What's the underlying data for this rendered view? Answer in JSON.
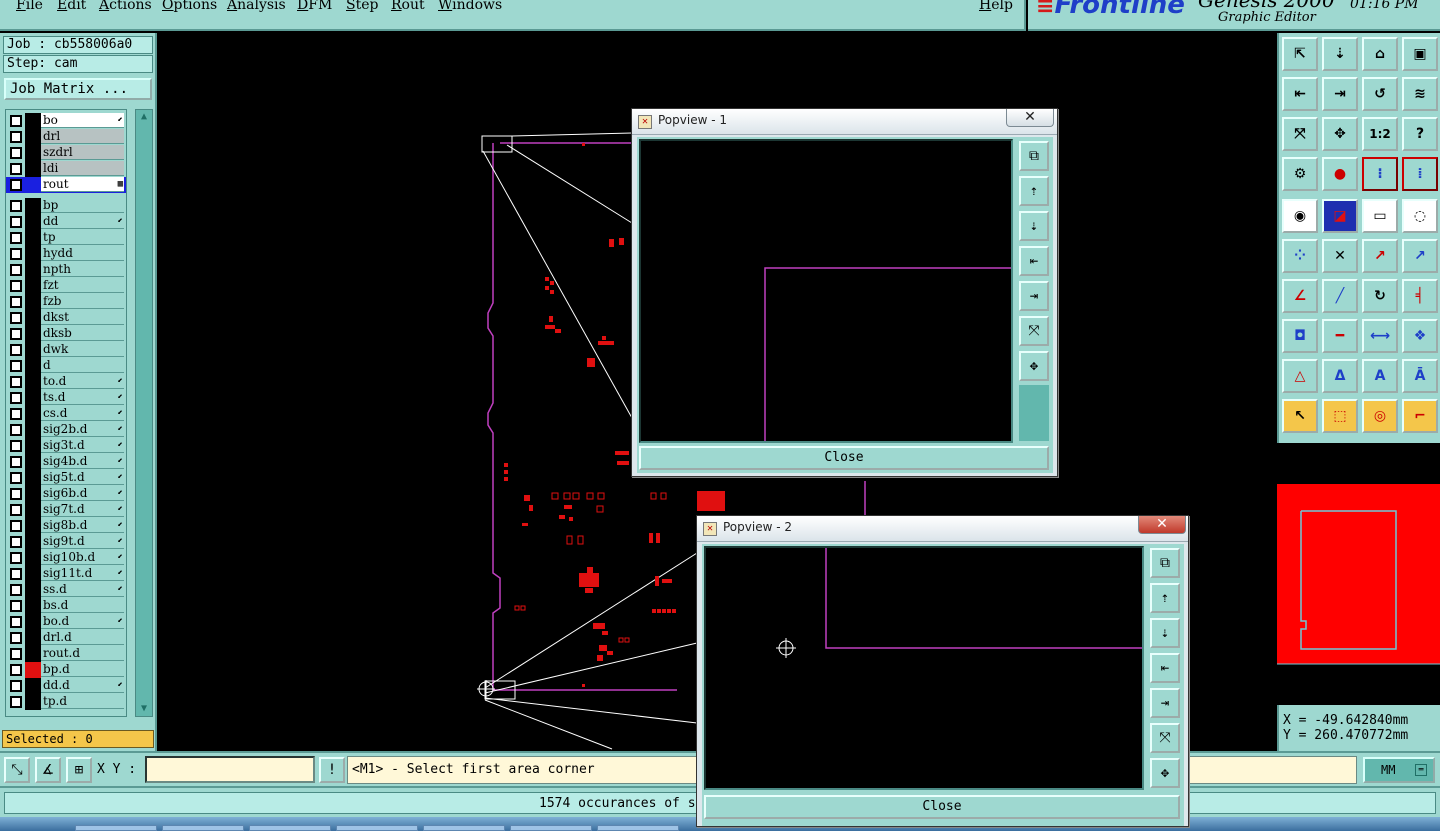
{
  "menu": {
    "items": [
      "File",
      "Edit",
      "Actions",
      "Options",
      "Analysis",
      "DFM",
      "Step",
      "Rout",
      "Windows"
    ],
    "help": "Help"
  },
  "brand": {
    "logo": "Frontline",
    "product": "Genesis 2000",
    "subtitle": "Graphic Editor",
    "time": "01:16 PM"
  },
  "job": {
    "job": "Job : cb558006a0",
    "step": "Step: cam",
    "matrix_button": "Job Matrix ..."
  },
  "layers": [
    {
      "name": "bo",
      "type": "white",
      "flag": "⬋",
      "sel": false
    },
    {
      "name": "drl",
      "type": "board",
      "flag": "",
      "sel": false
    },
    {
      "name": "szdrl",
      "type": "board",
      "flag": "",
      "sel": false
    },
    {
      "name": "ldi",
      "type": "board",
      "flag": "",
      "sel": false
    },
    {
      "name": "rout",
      "type": "white",
      "flag": "▦",
      "sel": true
    },
    {
      "name": "bp",
      "type": "",
      "flag": "",
      "sel": false
    },
    {
      "name": "dd",
      "type": "",
      "flag": "⬋",
      "sel": false
    },
    {
      "name": "tp",
      "type": "",
      "flag": "",
      "sel": false
    },
    {
      "name": "hydd",
      "type": "",
      "flag": "",
      "sel": false
    },
    {
      "name": "npth",
      "type": "",
      "flag": "",
      "sel": false
    },
    {
      "name": "fzt",
      "type": "",
      "flag": "",
      "sel": false
    },
    {
      "name": "fzb",
      "type": "",
      "flag": "",
      "sel": false
    },
    {
      "name": "dkst",
      "type": "",
      "flag": "",
      "sel": false
    },
    {
      "name": "dksb",
      "type": "",
      "flag": "",
      "sel": false
    },
    {
      "name": "dwk",
      "type": "",
      "flag": "",
      "sel": false
    },
    {
      "name": "d",
      "type": "",
      "flag": "",
      "sel": false
    },
    {
      "name": "to.d",
      "type": "",
      "flag": "⬋",
      "sel": false
    },
    {
      "name": "ts.d",
      "type": "",
      "flag": "⬋",
      "sel": false
    },
    {
      "name": "cs.d",
      "type": "",
      "flag": "⬋",
      "sel": false
    },
    {
      "name": "sig2b.d",
      "type": "",
      "flag": "⬋",
      "sel": false
    },
    {
      "name": "sig3t.d",
      "type": "",
      "flag": "⬋",
      "sel": false
    },
    {
      "name": "sig4b.d",
      "type": "",
      "flag": "⬋",
      "sel": false
    },
    {
      "name": "sig5t.d",
      "type": "",
      "flag": "⬋",
      "sel": false
    },
    {
      "name": "sig6b.d",
      "type": "",
      "flag": "⬋",
      "sel": false
    },
    {
      "name": "sig7t.d",
      "type": "",
      "flag": "⬋",
      "sel": false
    },
    {
      "name": "sig8b.d",
      "type": "",
      "flag": "⬋",
      "sel": false
    },
    {
      "name": "sig9t.d",
      "type": "",
      "flag": "⬋",
      "sel": false
    },
    {
      "name": "sig10b.d",
      "type": "",
      "flag": "⬋",
      "sel": false
    },
    {
      "name": "sig11t.d",
      "type": "",
      "flag": "⬋",
      "sel": false
    },
    {
      "name": "ss.d",
      "type": "",
      "flag": "⬋",
      "sel": false
    },
    {
      "name": "bs.d",
      "type": "",
      "flag": "",
      "sel": false
    },
    {
      "name": "bo.d",
      "type": "",
      "flag": "⬋",
      "sel": false
    },
    {
      "name": "drl.d",
      "type": "",
      "flag": "",
      "sel": false
    },
    {
      "name": "rout.d",
      "type": "",
      "flag": "",
      "sel": false
    },
    {
      "name": "bp.d",
      "type": "",
      "flag": "",
      "sel": false,
      "color": "#e01010"
    },
    {
      "name": "dd.d",
      "type": "",
      "flag": "⬋",
      "sel": false
    },
    {
      "name": "tp.d",
      "type": "",
      "flag": "",
      "sel": false
    }
  ],
  "selected": "Selected : 0",
  "coords": {
    "x": "X = -49.642840mm",
    "y": "Y = 260.470772mm"
  },
  "command": {
    "xy_label": "X Y :",
    "xy_value": "",
    "prompt": "<M1> - Select first area corner",
    "units": "MM"
  },
  "status": "1574 occurances of sele",
  "popview1": {
    "title": "Popview - 1",
    "close": "Close"
  },
  "popview2": {
    "title": "Popview - 2",
    "close": "Close"
  },
  "colors": {
    "panel": "#9ed8d0",
    "rout": "#c040c0",
    "features": "#e01010",
    "outline": "#ffffff",
    "minimap_bg": "#ff0000",
    "profile": "#70c8d8"
  }
}
